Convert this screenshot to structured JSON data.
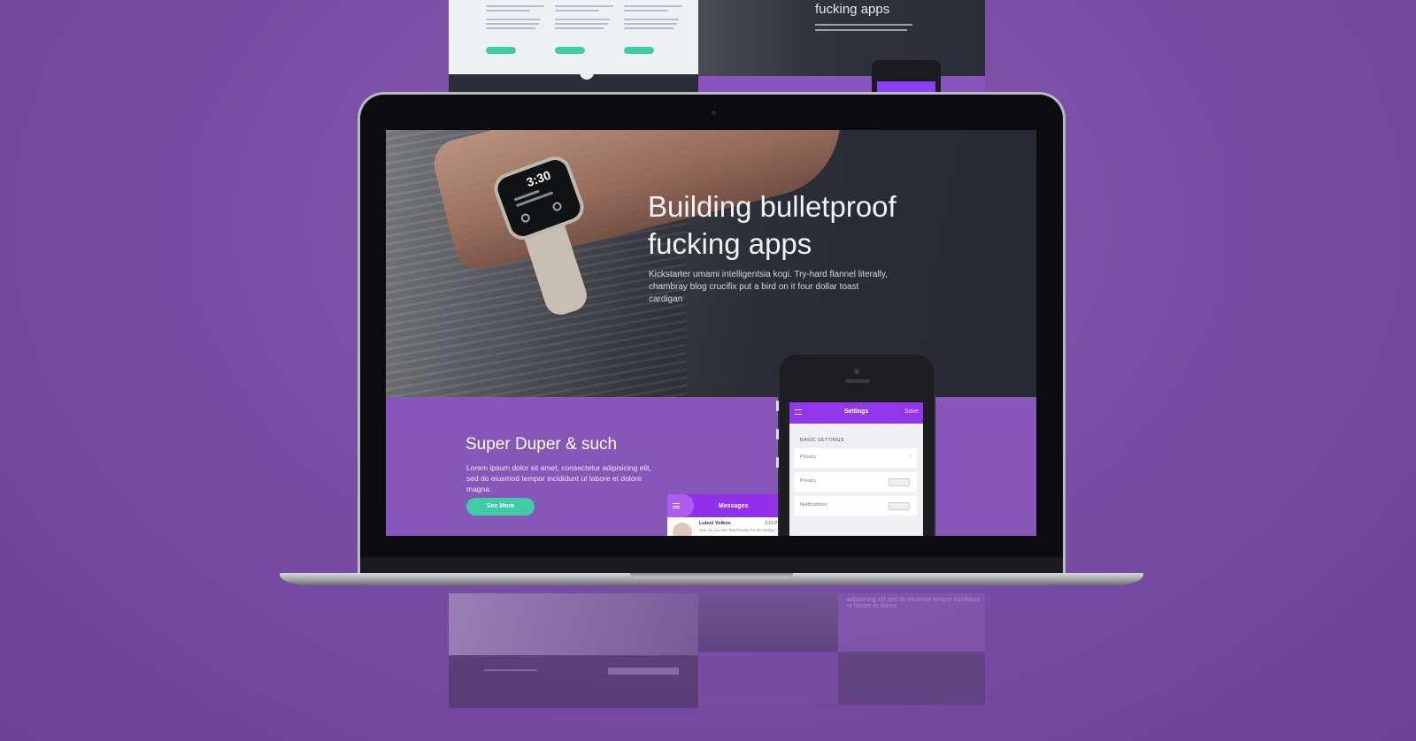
{
  "hero": {
    "title": "Building bulletproof fucking apps",
    "text": "Kickstarter umami intelligentsia kogi. Try-hard flannel literally, chambray blog crucifix put a bird on it four dollar toast cardigan"
  },
  "watch": {
    "time": "3:30"
  },
  "section": {
    "title": "Super Duper & such",
    "text": "Lorem ipsum dolor sit amet, consectetur adipisicing elit, sed do eiusmod tempor incididunt ut labore et dolore magna.",
    "button_label": "See More"
  },
  "messages_card": {
    "title": "Messages",
    "sender": "Luboš Volkov",
    "time": "3:21 PM",
    "preview": "Hey, do you see that friendly for the design?"
  },
  "phone": {
    "bar_title": "Settings",
    "save_label": "Save",
    "section_label": "BASIC SETTINGS",
    "rows": [
      {
        "label": "Privacy"
      },
      {
        "label": "Privacy"
      },
      {
        "label": "Notifications"
      }
    ]
  },
  "background_thumb": {
    "title": "fucking apps"
  },
  "reflection": {
    "text": "adipisicing elit sed do eiusmod tempor incididunt ut labore et dolore"
  },
  "colors": {
    "background": "#7a4ea6",
    "accent_green": "#3fcba5",
    "section_purple": "#8756b9",
    "phone_bar": "#9437ec",
    "hero_dark": "#2b2d36"
  },
  "icons": [
    "menu-icon",
    "chevron-right-icon",
    "camera-icon"
  ]
}
